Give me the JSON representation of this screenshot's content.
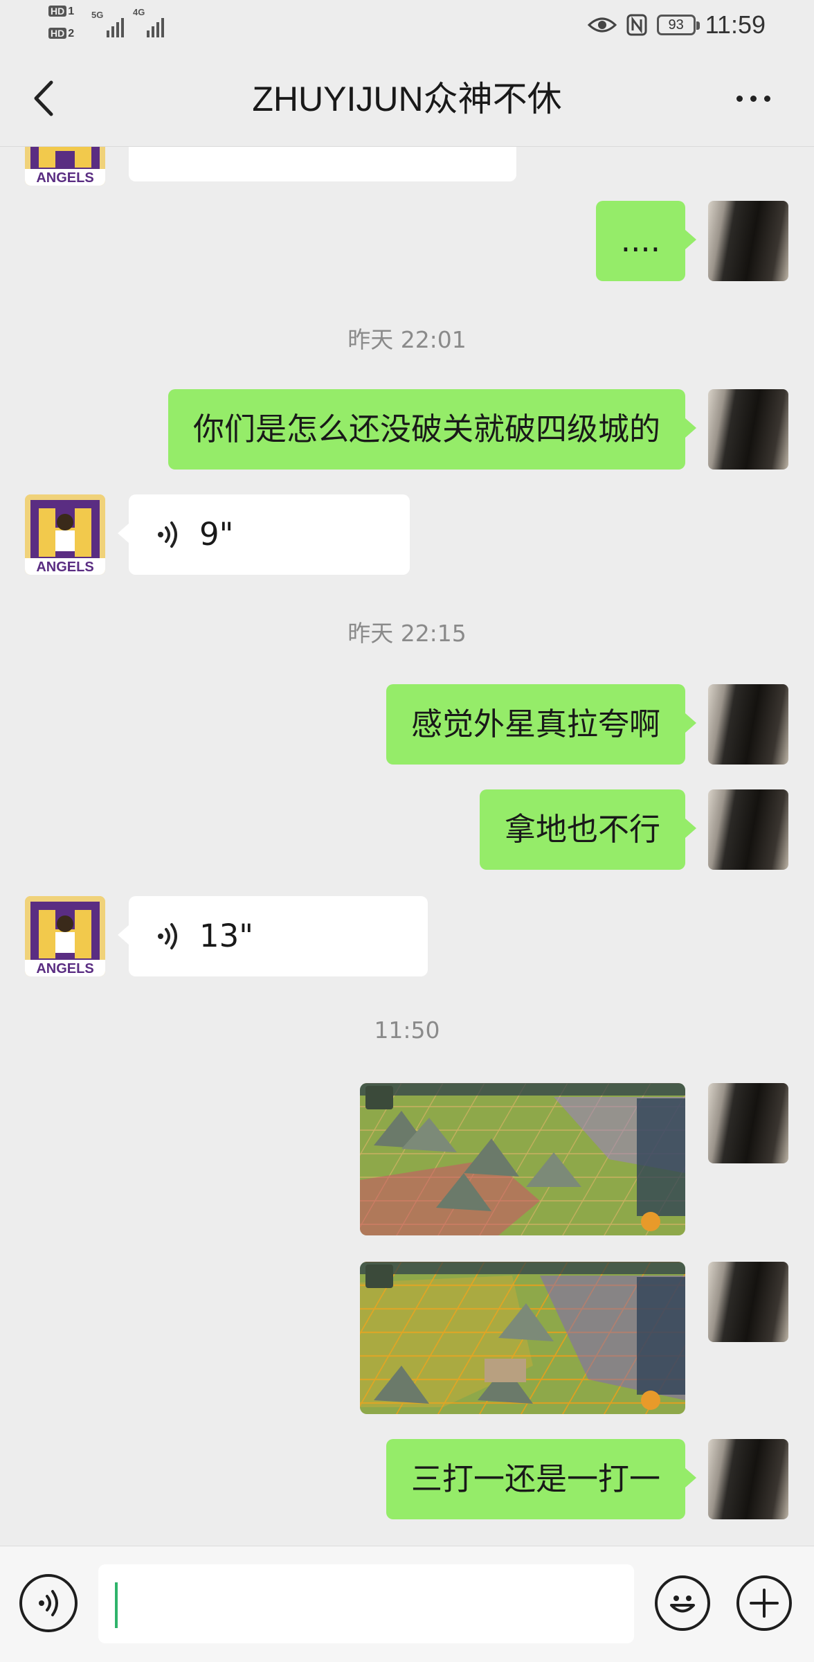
{
  "status_bar": {
    "hd1": "HD",
    "hd1_num": "1",
    "hd2": "HD",
    "hd2_num": "2",
    "net1": "5G",
    "net2": "4G",
    "battery": "93",
    "time": "11:59"
  },
  "header": {
    "title": "ZHUYIJUN众神不休",
    "back_icon": "chevron-left-icon",
    "more_icon": "more-dots-icon"
  },
  "messages": [
    {
      "type": "text",
      "from": "me",
      "text": "...."
    },
    {
      "type": "timestamp",
      "text": "昨天 22:01"
    },
    {
      "type": "text",
      "from": "me",
      "text": "你们是怎么还没破关就破四级城的"
    },
    {
      "type": "voice",
      "from": "other",
      "duration": "9\""
    },
    {
      "type": "timestamp",
      "text": "昨天 22:15"
    },
    {
      "type": "text",
      "from": "me",
      "text": "感觉外星真拉夸啊"
    },
    {
      "type": "text",
      "from": "me",
      "text": "拿地也不行"
    },
    {
      "type": "voice",
      "from": "other",
      "duration": "13\""
    },
    {
      "type": "timestamp",
      "text": "11:50"
    },
    {
      "type": "image",
      "from": "me",
      "description_icon": "game-screenshot-image"
    },
    {
      "type": "image",
      "from": "me",
      "description_icon": "game-screenshot-image"
    },
    {
      "type": "text",
      "from": "me",
      "text": "三打一还是一打一"
    }
  ],
  "avatar_badge": "ANGELS",
  "input_bar": {
    "voice_icon": "voice-input-icon",
    "emoji_icon": "emoji-icon",
    "plus_icon": "plus-icon",
    "value": ""
  },
  "colors": {
    "background": "#ededed",
    "my_bubble": "#95ec69",
    "other_bubble": "#ffffff",
    "caret": "#2fb36b"
  }
}
